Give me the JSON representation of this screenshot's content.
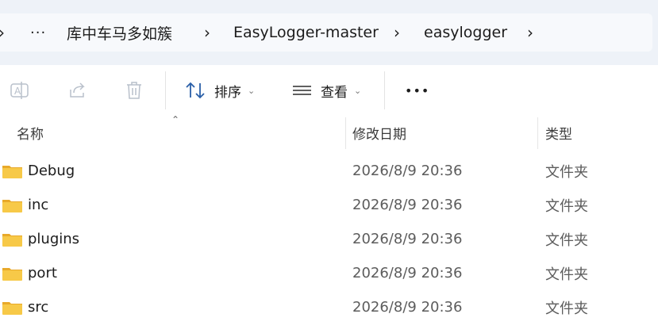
{
  "breadcrumb": {
    "items": [
      "库中车马多如簇",
      "EasyLogger-master",
      "easylogger"
    ],
    "overflow": "···"
  },
  "toolbar": {
    "sort_label": "排序",
    "view_label": "查看",
    "more_label": "•••"
  },
  "columns": {
    "name": "名称",
    "date": "修改日期",
    "type": "类型"
  },
  "files": [
    {
      "name": "Debug",
      "date": "2026/8/9 20:36",
      "type": "文件夹"
    },
    {
      "name": "inc",
      "date": "2026/8/9 20:36",
      "type": "文件夹"
    },
    {
      "name": "plugins",
      "date": "2026/8/9 20:36",
      "type": "文件夹"
    },
    {
      "name": "port",
      "date": "2026/8/9 20:36",
      "type": "文件夹"
    },
    {
      "name": "src",
      "date": "2026/8/9 20:36",
      "type": "文件夹"
    }
  ],
  "colors": {
    "folder_body": "#f7c948",
    "folder_tab": "#e8a92a",
    "address_bg": "#f7f9fc",
    "strip_bg": "#eef2f8"
  }
}
